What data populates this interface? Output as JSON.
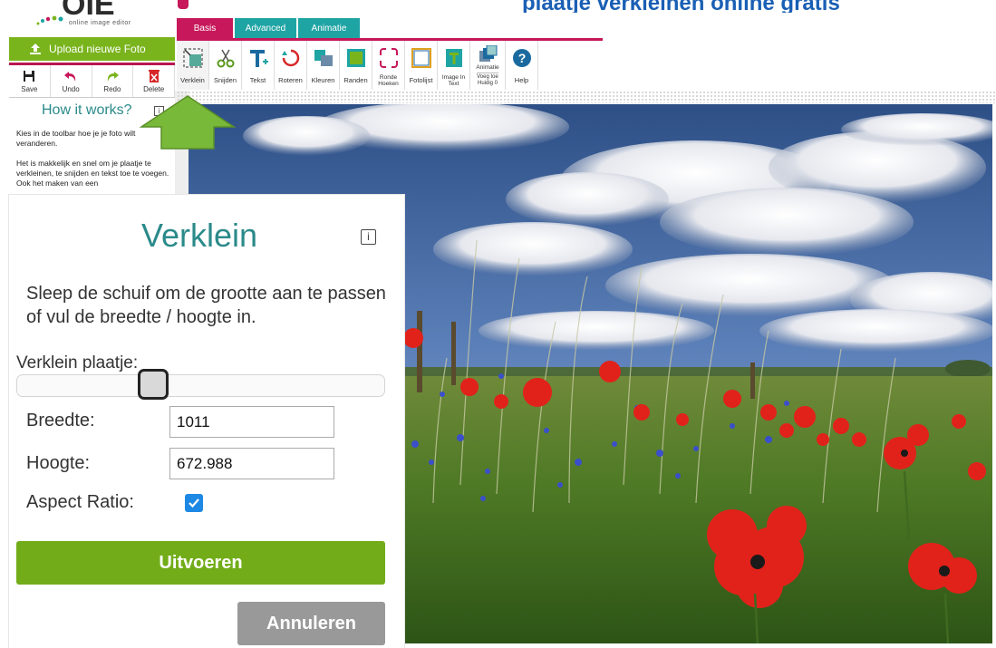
{
  "app": {
    "logo_tagline": "online image editor",
    "top_title": "plaatje verkleinen online gratis"
  },
  "sidebar": {
    "upload_label": "Upload nieuwe Foto",
    "edit_tools": [
      {
        "label": "Save",
        "icon": "save-icon"
      },
      {
        "label": "Undo",
        "icon": "undo-icon"
      },
      {
        "label": "Redo",
        "icon": "redo-icon"
      },
      {
        "label": "Delete",
        "icon": "delete-icon"
      }
    ],
    "how_title": "How it works?",
    "how_p1": "Kies in de toolbar hoe je je foto wilt veranderen.",
    "how_p2": "Het is makkelijk en snel om je plaatje te verkleinen, te snijden en tekst toe te voegen. Ook het maken van een"
  },
  "tabs": {
    "basis": "Basis",
    "advanced": "Advanced",
    "animatie": "Animatie"
  },
  "toolbar": {
    "verklein": "Verklein",
    "snijden": "Snijden",
    "tekst": "Tekst",
    "roteren": "Roteren",
    "kleuren": "Kleuren",
    "randen": "Randen",
    "ronde_1": "Ronde",
    "ronde_2": "Hoeken",
    "fotolijst": "Fotolijst",
    "imagetext_1": "Image In",
    "imagetext_2": "Text",
    "animatie_top": "Animatie",
    "animatie_1": "Voeg toe",
    "animatie_2": "Huidig 0",
    "help": "Help"
  },
  "panel": {
    "title": "Verklein",
    "info_icon": "i",
    "description": "Sleep de schuif om de grootte aan te passen of vul de breedte / hoogte in.",
    "slider_label": "Verklein plaatje:",
    "slider_value_fraction": 0.37,
    "width_label": "Breedte:",
    "width_value": "1011",
    "height_label": "Hoogte:",
    "height_value": "672.988",
    "aspect_label": "Aspect Ratio:",
    "aspect_checked": true,
    "run_label": "Uitvoeren",
    "cancel_label": "Annuleren"
  },
  "colors": {
    "accent_magenta": "#c6185a",
    "accent_teal": "#1fa4a4",
    "green": "#72ad19",
    "checkbox_blue": "#1e88e5"
  }
}
